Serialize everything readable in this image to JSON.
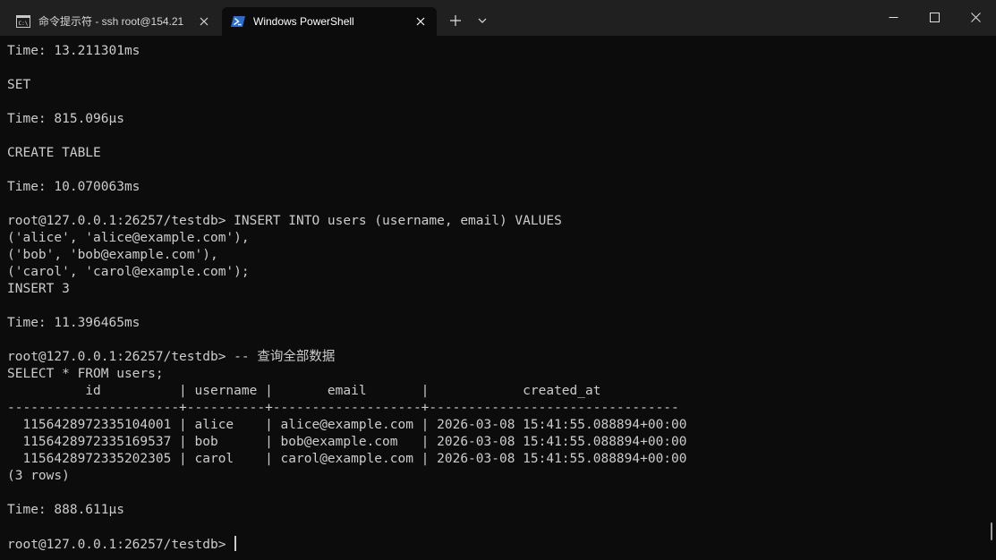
{
  "tabs": [
    {
      "label": "命令提示符 - ssh  root@154.21",
      "icon": "cmd-icon",
      "active": false
    },
    {
      "label": "Windows PowerShell",
      "icon": "powershell-icon",
      "active": true
    }
  ],
  "colors": {
    "titlebar_bg": "#202020",
    "terminal_bg": "#0c0c0c",
    "terminal_fg": "#cccccc",
    "powershell_blue": "#2b6cd1"
  },
  "terminal": {
    "lines": [
      "Time: 13.211301ms",
      "",
      "SET",
      "",
      "Time: 815.096µs",
      "",
      "CREATE TABLE",
      "",
      "Time: 10.070063ms",
      "",
      "root@127.0.0.1:26257/testdb> INSERT INTO users (username, email) VALUES",
      "('alice', 'alice@example.com'),",
      "('bob', 'bob@example.com'),",
      "('carol', 'carol@example.com');",
      "INSERT 3",
      "",
      "Time: 11.396465ms",
      "",
      "root@127.0.0.1:26257/testdb> -- 查询全部数据",
      "SELECT * FROM users;",
      "          id          | username |       email       |            created_at",
      "----------------------+----------+-------------------+--------------------------------",
      "  1156428972335104001 | alice    | alice@example.com | 2026-03-08 15:41:55.088894+00:00",
      "  1156428972335169537 | bob      | bob@example.com   | 2026-03-08 15:41:55.088894+00:00",
      "  1156428972335202305 | carol    | carol@example.com | 2026-03-08 15:41:55.088894+00:00",
      "(3 rows)",
      "",
      "Time: 888.611µs",
      ""
    ],
    "prompt": "root@127.0.0.1:26257/testdb> "
  }
}
